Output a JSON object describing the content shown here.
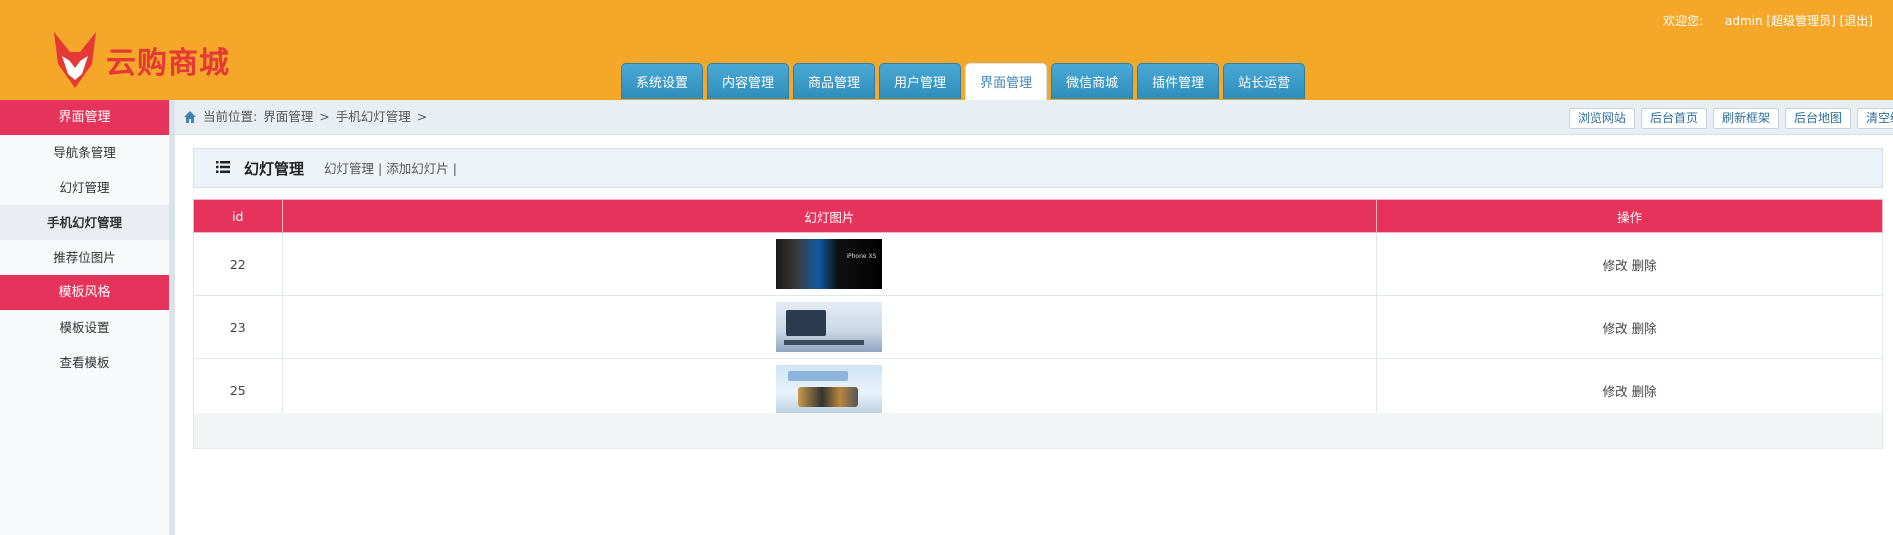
{
  "header": {
    "logo_text": "云购商城",
    "welcome": "欢迎您:",
    "username": "admin",
    "role": "[超级管理员]",
    "logout": "[退出]"
  },
  "nav": {
    "tabs": [
      {
        "label": "系统设置"
      },
      {
        "label": "内容管理"
      },
      {
        "label": "商品管理"
      },
      {
        "label": "用户管理"
      },
      {
        "label": "界面管理",
        "active": true
      },
      {
        "label": "微信商城"
      },
      {
        "label": "插件管理"
      },
      {
        "label": "站长运营"
      }
    ]
  },
  "sidebar": {
    "cat1": "界面管理",
    "items1": [
      "导航条管理",
      "幻灯管理",
      "手机幻灯管理",
      "推荐位图片"
    ],
    "cat2": "模板风格",
    "items2": [
      "模板设置",
      "查看模板"
    ]
  },
  "breadcrumb": {
    "prefix": "当前位置:",
    "level1": "界面管理",
    "sep": ">",
    "level2": "手机幻灯管理"
  },
  "quick_buttons": [
    "浏览网站",
    "后台首页",
    "刷新框架",
    "后台地图",
    "清空缓存"
  ],
  "panel": {
    "title": "幻灯管理",
    "link1": "幻灯管理",
    "link2": "添加幻灯片",
    "sep": "|"
  },
  "table": {
    "headers": [
      "id",
      "幻灯图片",
      "操作"
    ],
    "rows": [
      {
        "id": "22",
        "edit": "修改",
        "delete": "删除"
      },
      {
        "id": "23",
        "edit": "修改",
        "delete": "删除"
      },
      {
        "id": "25",
        "edit": "修改",
        "delete": "删除"
      }
    ]
  },
  "colors": {
    "header_bg": "#f5a72a",
    "accent_red": "#e6335b",
    "tab_blue": "#2f8dbb"
  }
}
